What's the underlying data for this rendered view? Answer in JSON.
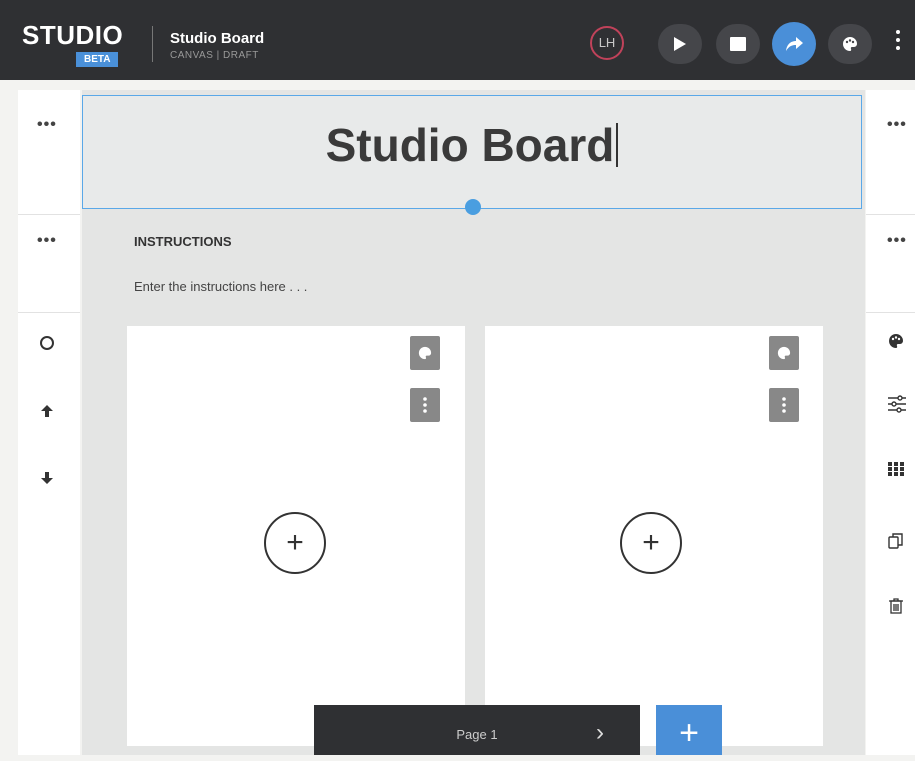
{
  "app": {
    "logo": "STUDIO",
    "badge": "BETA",
    "doc_title": "Studio Board",
    "doc_subtitle": "CANVAS | DRAFT",
    "avatar_initials": "LH",
    "accent_color": "#4a8fd8"
  },
  "toolbar": {
    "icons": [
      "play-icon",
      "stop-icon",
      "share-icon",
      "palette-icon",
      "more-icon"
    ]
  },
  "canvas": {
    "title": "Studio Board",
    "instructions_label": "INSTRUCTIONS",
    "instructions_placeholder": "Enter the instructions here . . ."
  },
  "left_rail": {
    "menu_glyph": "•••",
    "icons": [
      "circle-icon",
      "arrow-up-icon",
      "arrow-down-icon"
    ]
  },
  "right_rail": {
    "menu_glyph": "•••",
    "icons": [
      "palette-icon",
      "sliders-icon",
      "grid-icon",
      "duplicate-icon",
      "trash-icon"
    ]
  },
  "cards": [
    {
      "add_symbol": "+"
    },
    {
      "add_symbol": "+"
    }
  ],
  "pager": {
    "label": "Page 1",
    "next_symbol": "›",
    "add_symbol": "+"
  }
}
